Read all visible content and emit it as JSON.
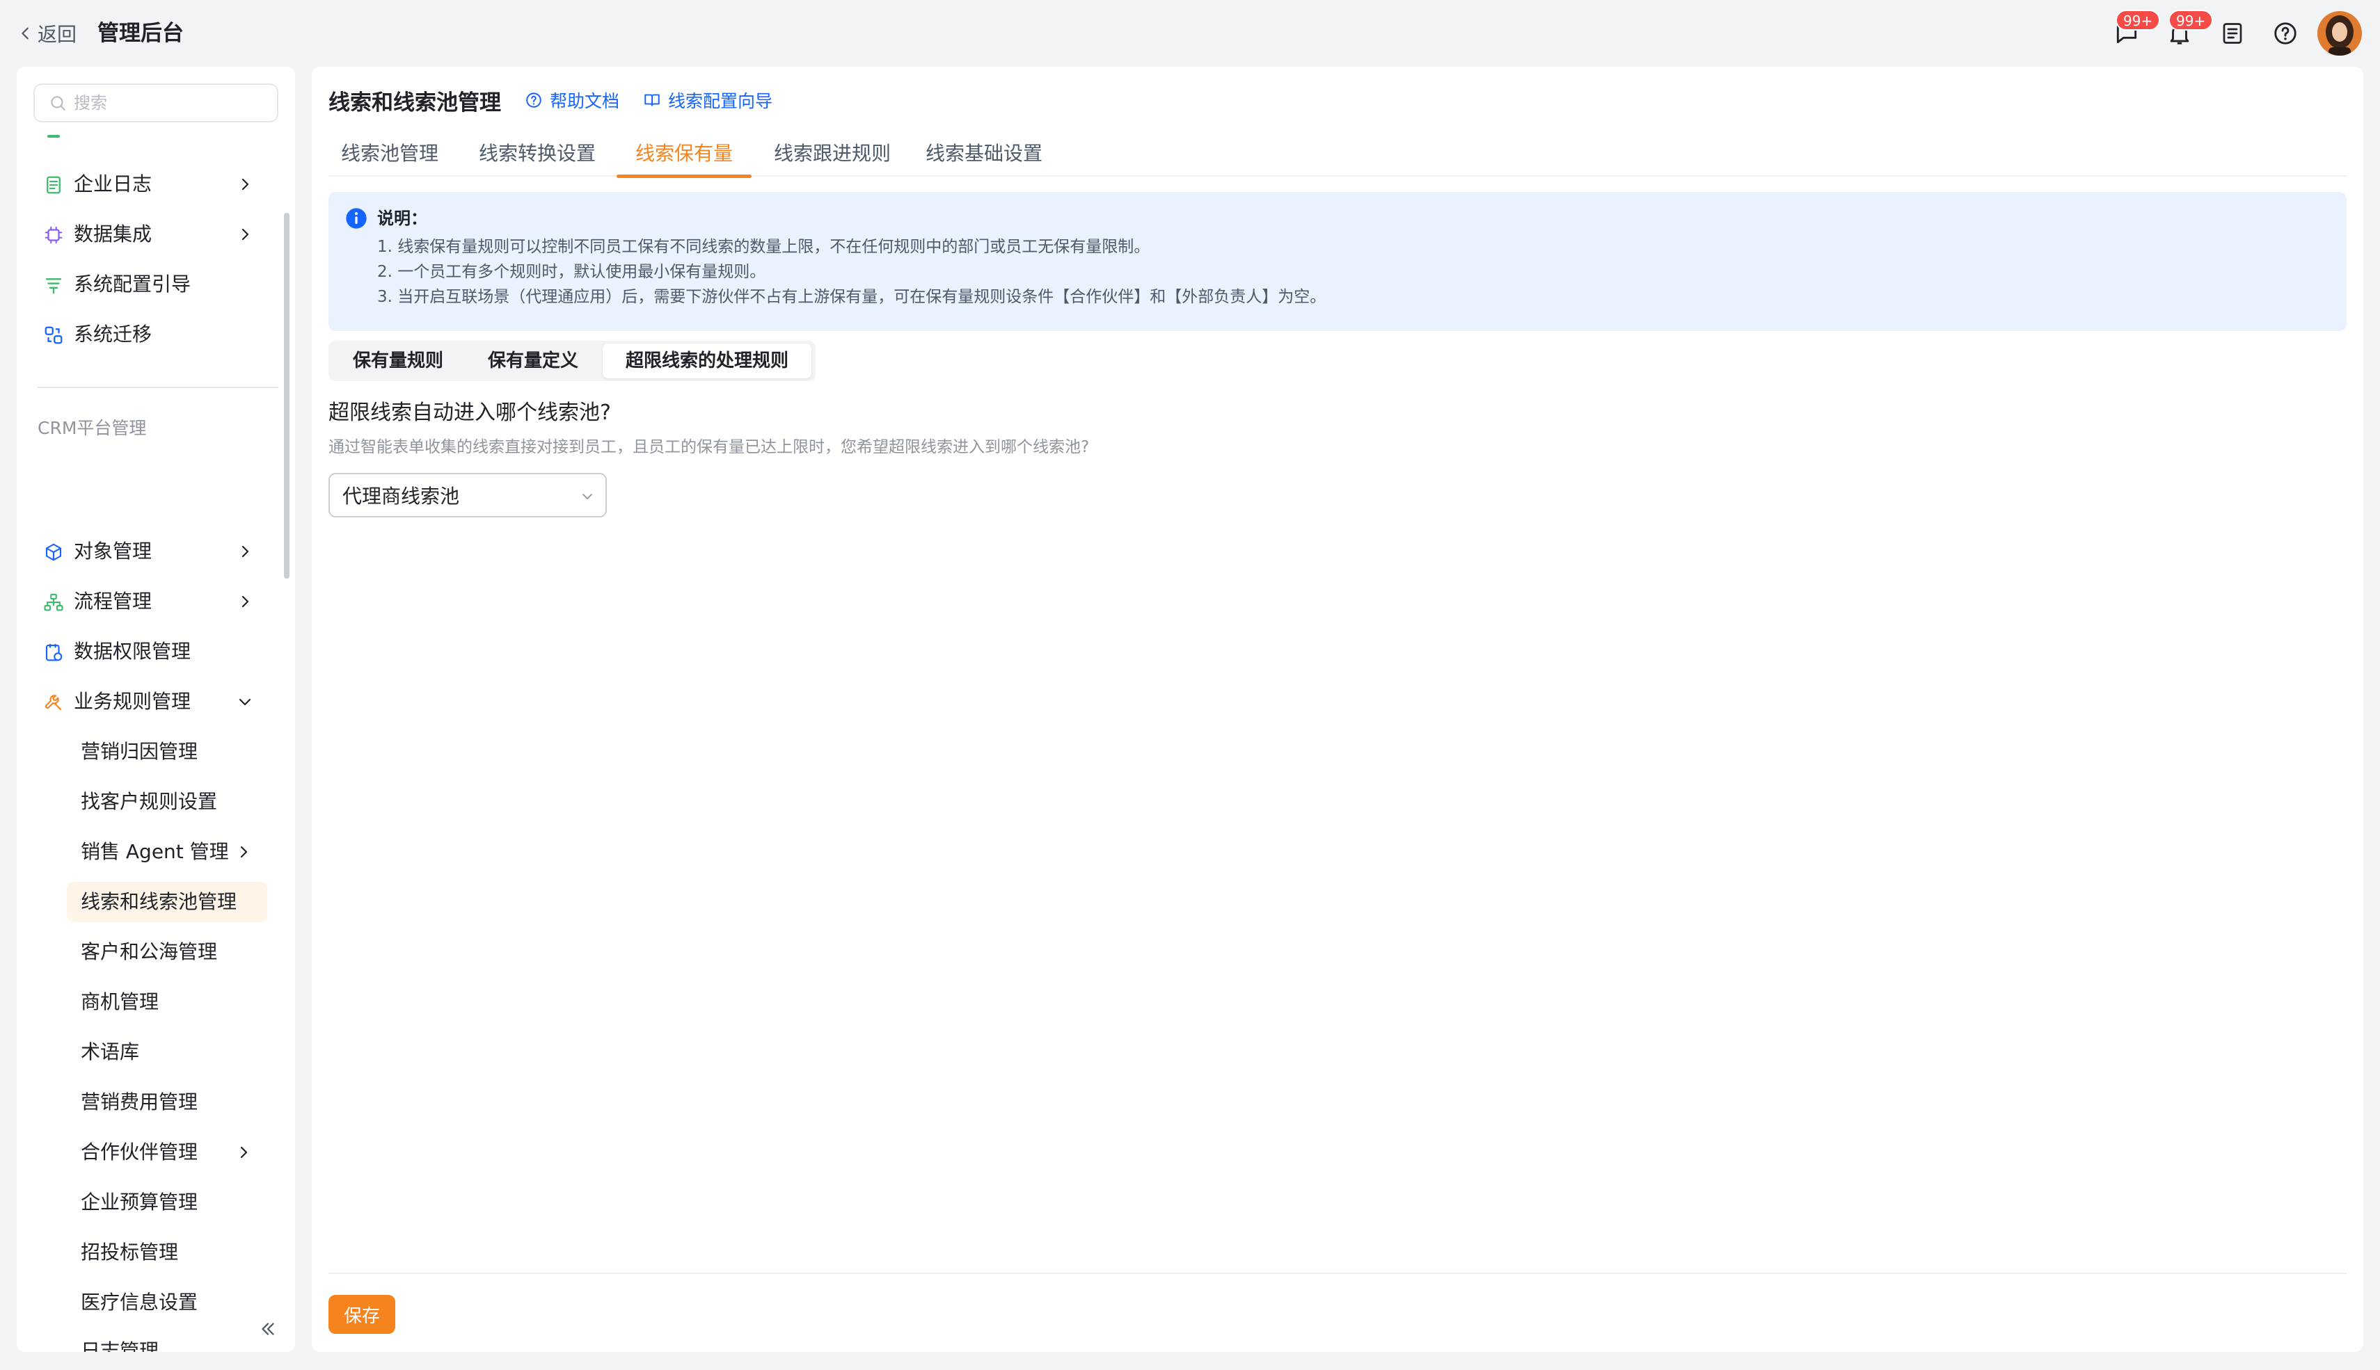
{
  "header": {
    "back_label": "返回",
    "app_title": "管理后台",
    "chat_badge": "99+",
    "notify_badge": "99+"
  },
  "sidebar": {
    "search_placeholder": "搜索",
    "items_top": [
      {
        "label": "企业日志",
        "icon": "log-icon",
        "expandable": true
      },
      {
        "label": "数据集成",
        "icon": "chip-icon",
        "expandable": true
      },
      {
        "label": "系统配置引导",
        "icon": "config-icon",
        "expandable": false
      },
      {
        "label": "系统迁移",
        "icon": "migrate-icon",
        "expandable": false
      }
    ],
    "group_label": "CRM平台管理",
    "items_crm": [
      {
        "label": "对象管理",
        "icon": "cube-icon",
        "expandable": true
      },
      {
        "label": "流程管理",
        "icon": "flow-icon",
        "expandable": true
      },
      {
        "label": "数据权限管理",
        "icon": "permission-icon",
        "expandable": false
      },
      {
        "label": "业务规则管理",
        "icon": "wrench-icon",
        "expandable": true,
        "expanded": true
      }
    ],
    "sub_items": [
      {
        "label": "营销归因管理"
      },
      {
        "label": "找客户规则设置"
      },
      {
        "label": "销售 Agent 管理",
        "expandable": true
      },
      {
        "label": "线索和线索池管理",
        "active": true
      },
      {
        "label": "客户和公海管理"
      },
      {
        "label": "商机管理"
      },
      {
        "label": "术语库"
      },
      {
        "label": "营销费用管理"
      },
      {
        "label": "合作伙伴管理",
        "expandable": true
      },
      {
        "label": "企业预算管理"
      },
      {
        "label": "招投标管理"
      },
      {
        "label": "医疗信息设置"
      },
      {
        "label": "日志管理"
      }
    ]
  },
  "main": {
    "title": "线索和线索池管理",
    "help_link": "帮助文档",
    "guide_link": "线索配置向导",
    "tabs": [
      {
        "label": "线索池管理"
      },
      {
        "label": "线索转换设置"
      },
      {
        "label": "线索保有量",
        "active": true
      },
      {
        "label": "线索跟进规则"
      },
      {
        "label": "线索基础设置"
      }
    ],
    "info": {
      "title": "说明：",
      "lines": [
        "1. 线索保有量规则可以控制不同员工保有不同线索的数量上限，不在任何规则中的部门或员工无保有量限制。",
        "2. 一个员工有多个规则时，默认使用最小保有量规则。",
        "3. 当开启互联场景（代理通应用）后，需要下游伙伴不占有上游保有量，可在保有量规则设条件【合作伙伴】和【外部负责人】为空。"
      ]
    },
    "sub_tabs": [
      {
        "label": "保有量规则"
      },
      {
        "label": "保有量定义"
      },
      {
        "label": "超限线索的处理规则",
        "active": true
      }
    ],
    "question": "超限线索自动进入哪个线索池?",
    "question_desc": "通过智能表单收集的线索直接对接到员工，且员工的保有量已达上限时，您希望超限线索进入到哪个线索池?",
    "select_value": "代理商线索池",
    "save_label": "保存"
  },
  "colors": {
    "accent": "#f5841f",
    "link": "#1664ff",
    "info_bg": "#e8f3ff",
    "badge": "#f54a45"
  }
}
